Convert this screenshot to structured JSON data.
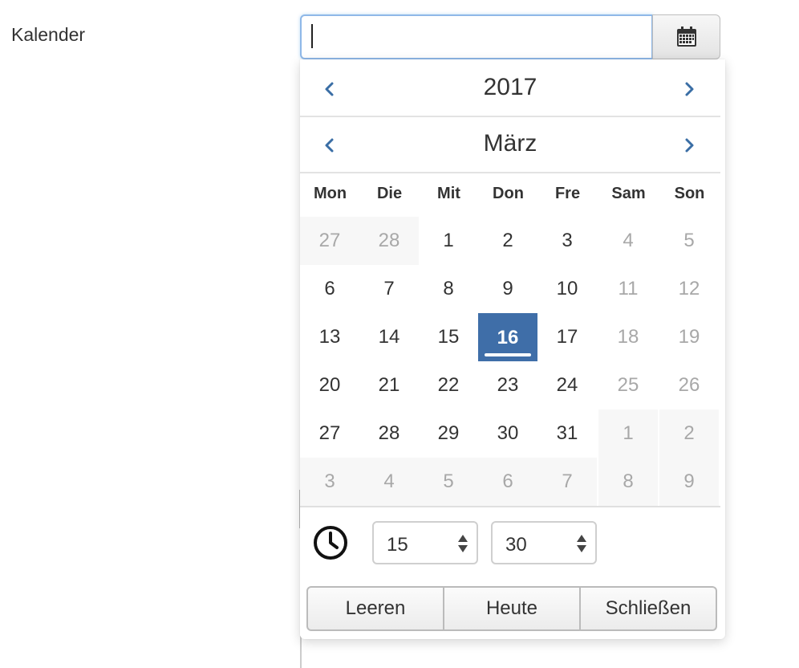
{
  "form": {
    "label": "Kalender",
    "input_value": "",
    "calendar_button_icon": "calendar-icon"
  },
  "picker": {
    "year": "2017",
    "month": "März",
    "weekdays": [
      "Mon",
      "Die",
      "Mit",
      "Don",
      "Fre",
      "Sam",
      "Son"
    ],
    "weeks": [
      [
        "27",
        "28",
        "1",
        "2",
        "3",
        "4",
        "5"
      ],
      [
        "6",
        "7",
        "8",
        "9",
        "10",
        "11",
        "12"
      ],
      [
        "13",
        "14",
        "15",
        "16",
        "17",
        "18",
        "19"
      ],
      [
        "20",
        "21",
        "22",
        "23",
        "24",
        "25",
        "26"
      ],
      [
        "27",
        "28",
        "29",
        "30",
        "31",
        "1",
        "2"
      ],
      [
        "3",
        "4",
        "5",
        "6",
        "7",
        "8",
        "9"
      ]
    ],
    "selected_day": "16",
    "time": {
      "icon": "clock-icon",
      "hour": "15",
      "minute": "30"
    },
    "buttons": {
      "clear": "Leeren",
      "today": "Heute",
      "close": "Schließen"
    }
  },
  "colors": {
    "accent": "#3f6ea8",
    "nav_arrow": "#3a6ea5",
    "muted_text": "#a8a8a8",
    "focus_border": "#8fb8e8"
  }
}
